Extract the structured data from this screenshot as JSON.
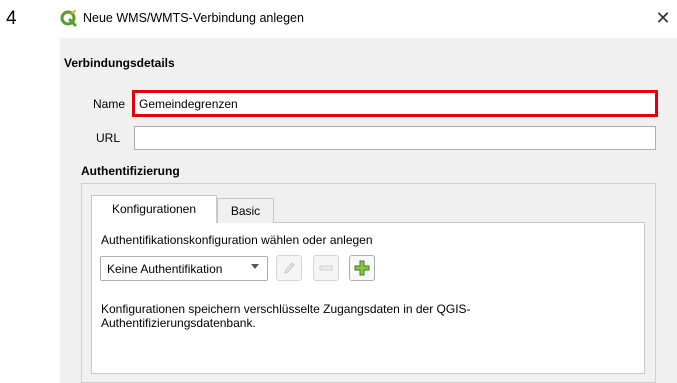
{
  "step_number": "4",
  "window": {
    "title": "Neue WMS/WMTS-Verbindung anlegen",
    "close_symbol": "✕",
    "app_icon": "qgis-logo-icon",
    "accent_color": "#5a9b2d"
  },
  "connection_details": {
    "section_title": "Verbindungsdetails",
    "name_label": "Name",
    "name_value": "Gemeindegrenzen",
    "name_highlight_color": "#e2000f",
    "url_label": "URL",
    "url_value": ""
  },
  "authentication": {
    "section_title": "Authentifizierung",
    "tabs": [
      {
        "label": "Konfigurationen",
        "active": true
      },
      {
        "label": "Basic",
        "active": false
      }
    ],
    "choose_label": "Authentifikationskonfiguration wählen oder anlegen",
    "config_select_value": "Keine Authentifikation",
    "buttons": [
      {
        "icon": "edit-pencil-icon",
        "enabled": false
      },
      {
        "icon": "remove-icon",
        "enabled": false
      },
      {
        "icon": "add-plus-icon",
        "enabled": true
      }
    ],
    "info_text_line1": "Konfigurationen speichern verschlüsselte Zugangsdaten in der QGIS-",
    "info_text_line2": "Authentifizierungsdatenbank."
  }
}
